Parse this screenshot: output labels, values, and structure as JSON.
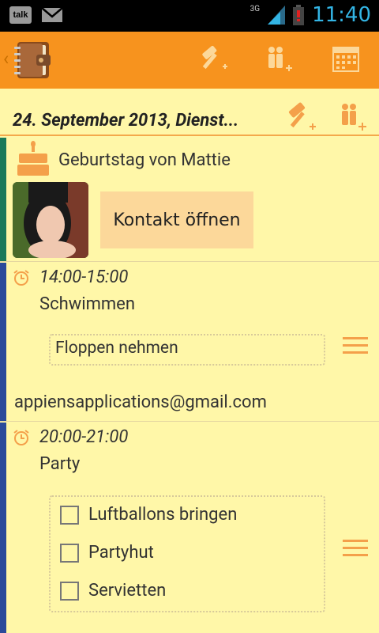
{
  "status": {
    "talk": "talk",
    "network": "3G",
    "time": "11:40"
  },
  "actionbar": {
    "icons": [
      "planner-logo-icon",
      "new-task-icon",
      "new-event-icon",
      "calendar-icon"
    ]
  },
  "date_header": {
    "date": "24. September 2013, Dienst..."
  },
  "birthday": {
    "title": "Geburtstag von Mattie",
    "button": "Kontakt öffnen"
  },
  "event1": {
    "time": "14:00-15:00",
    "title": "Schwimmen",
    "note": "Floppen nehmen",
    "email": "appiensapplications@gmail.com"
  },
  "event2": {
    "time": "20:00-21:00",
    "title": "Party",
    "checklist": [
      {
        "label": "Luftballons bringen",
        "checked": false
      },
      {
        "label": "Partyhut",
        "checked": false
      },
      {
        "label": "Servietten",
        "checked": false
      }
    ]
  },
  "colors": {
    "actionbar": "#F7931E",
    "background": "#FFF7A8",
    "birthday_bar": "#1a7a5a",
    "event_bar": "#2a4a9a",
    "accent": "#F4A04A"
  }
}
